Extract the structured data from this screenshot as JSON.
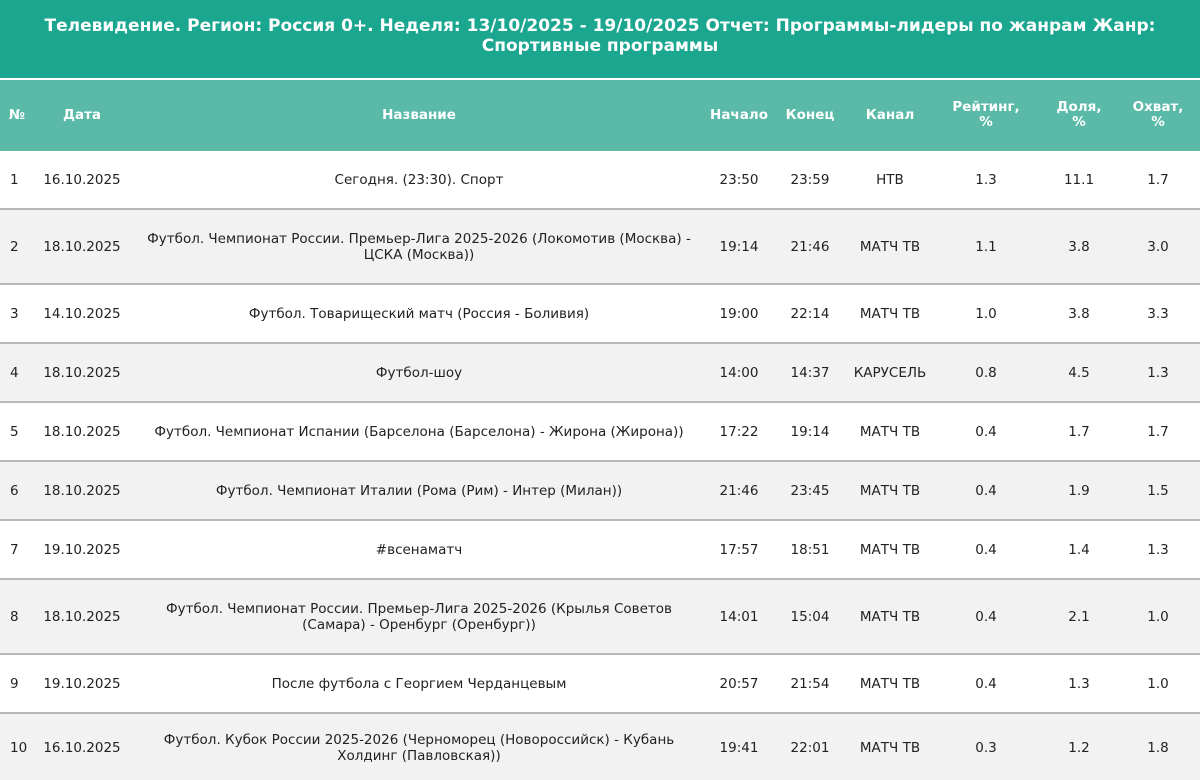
{
  "report": {
    "title": "Телевидение. Регион: Россия 0+. Неделя: 13/10/2025 - 19/10/2025 Отчет: Программы-лидеры по жанрам Жанр: Спортивные программы"
  },
  "columns": {
    "num": "№",
    "date": "Дата",
    "name": "Название",
    "start": "Начало",
    "end": "Конец",
    "channel": "Канал",
    "rating_line1": "Рейтинг,",
    "rating_line2": "%",
    "share_line1": "Доля,",
    "share_line2": "%",
    "reach_line1": "Охват,",
    "reach_line2": "%"
  },
  "rows": [
    {
      "num": "1",
      "date": "16.10.2025",
      "name": "Сегодня. (23:30). Спорт",
      "start": "23:50",
      "end": "23:59",
      "channel": "НТВ",
      "rating": "1.3",
      "share": "11.1",
      "reach": "1.7"
    },
    {
      "num": "2",
      "date": "18.10.2025",
      "name": "Футбол. Чемпионат России. Премьер-Лига 2025-2026 (Локомотив (Москва) - ЦСКА (Москва))",
      "start": "19:14",
      "end": "21:46",
      "channel": "МАТЧ ТВ",
      "rating": "1.1",
      "share": "3.8",
      "reach": "3.0"
    },
    {
      "num": "3",
      "date": "14.10.2025",
      "name": "Футбол. Товарищеский матч (Россия - Боливия)",
      "start": "19:00",
      "end": "22:14",
      "channel": "МАТЧ ТВ",
      "rating": "1.0",
      "share": "3.8",
      "reach": "3.3"
    },
    {
      "num": "4",
      "date": "18.10.2025",
      "name": "Футбол-шоу",
      "start": "14:00",
      "end": "14:37",
      "channel": "КАРУСЕЛЬ",
      "rating": "0.8",
      "share": "4.5",
      "reach": "1.3"
    },
    {
      "num": "5",
      "date": "18.10.2025",
      "name": "Футбол. Чемпионат Испании (Барселона (Барселона) - Жирона (Жирона))",
      "start": "17:22",
      "end": "19:14",
      "channel": "МАТЧ ТВ",
      "rating": "0.4",
      "share": "1.7",
      "reach": "1.7"
    },
    {
      "num": "6",
      "date": "18.10.2025",
      "name": "Футбол. Чемпионат Италии (Рома (Рим) - Интер (Милан))",
      "start": "21:46",
      "end": "23:45",
      "channel": "МАТЧ ТВ",
      "rating": "0.4",
      "share": "1.9",
      "reach": "1.5"
    },
    {
      "num": "7",
      "date": "19.10.2025",
      "name": "#всенаматч",
      "start": "17:57",
      "end": "18:51",
      "channel": "МАТЧ ТВ",
      "rating": "0.4",
      "share": "1.4",
      "reach": "1.3"
    },
    {
      "num": "8",
      "date": "18.10.2025",
      "name": "Футбол. Чемпионат России. Премьер-Лига 2025-2026 (Крылья Советов (Самара) - Оренбург (Оренбург))",
      "start": "14:01",
      "end": "15:04",
      "channel": "МАТЧ ТВ",
      "rating": "0.4",
      "share": "2.1",
      "reach": "1.0"
    },
    {
      "num": "9",
      "date": "19.10.2025",
      "name": "После футбола с Георгием Черданцевым",
      "start": "20:57",
      "end": "21:54",
      "channel": "МАТЧ ТВ",
      "rating": "0.4",
      "share": "1.3",
      "reach": "1.0"
    },
    {
      "num": "10",
      "date": "16.10.2025",
      "name": "Футбол. Кубок России 2025-2026 (Черноморец (Новороссийск) - Кубань Холдинг (Павловская))",
      "start": "19:41",
      "end": "22:01",
      "channel": "МАТЧ ТВ",
      "rating": "0.3",
      "share": "1.2",
      "reach": "1.8"
    }
  ]
}
